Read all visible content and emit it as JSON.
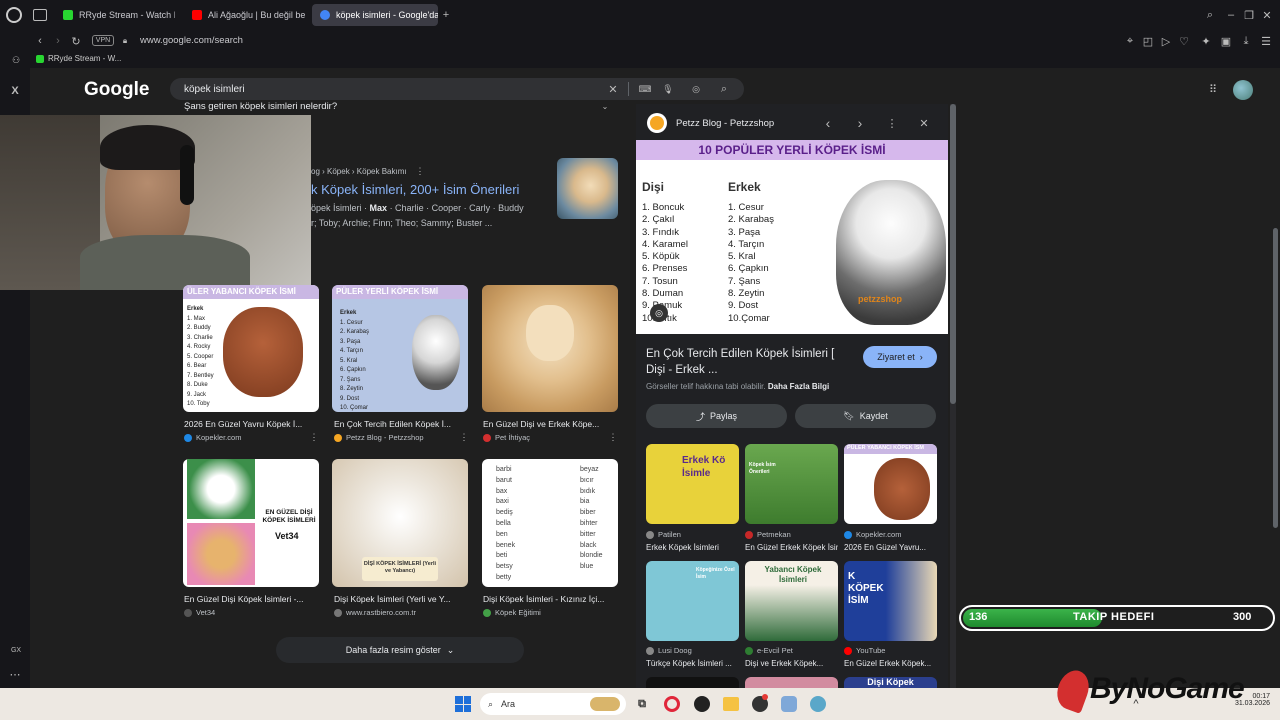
{
  "browser": {
    "tabs": [
      {
        "label": "RRyde Stream - Watch Liv",
        "color": "#28d631"
      },
      {
        "label": "Ali Ağaoğlu | Bu değil ben",
        "color": "#ff0000"
      },
      {
        "label": "köpek isimleri - Google'da",
        "color": "#4285f4"
      }
    ],
    "url": "www.google.com/search",
    "vpn_label": "VPN",
    "bookmark": "RRyde Stream - W..."
  },
  "sidebar": {
    "x_label": "X",
    "gx_label": "GX"
  },
  "google": {
    "logo": "Google",
    "query": "köpek isimleri",
    "top_snippet": "Şans getiren köpek isimleri nelerdir?",
    "result": {
      "breadcrumb": "og › Köpek › Köpek Bakımı",
      "title": "k Köpek İsimleri, 200+ İsim Önerileri",
      "line1_pre": "öpek İsimleri ·",
      "line1_bold": "Max",
      "line1_post": "· Charlie · Cooper · Carly · Buddy",
      "line2": "r; Toby; Archie; Finn; Theo; Sammy; Buster ..."
    },
    "images": [
      {
        "caption": "2026 En Güzel Yavru Köpek İ...",
        "source": "Kopekler.com",
        "title_text": "ÜLER YABANCI KÖPEK İSMİ",
        "src_color": "#1e88e5"
      },
      {
        "caption": "En Çok Tercih Edilen Köpek İ...",
        "source": "Petzz Blog - Petzzshop",
        "title_text": "PÜLER YERLİ KÖPEK İSMİ",
        "src_color": "#f5a623"
      },
      {
        "caption": "En Güzel Dişi ve Erkek Köpe...",
        "source": "Pet İhtiyaç",
        "title_text": "",
        "src_color": "#d32f2f"
      },
      {
        "caption": "En Güzel Dişi Köpek İsimleri -...",
        "source": "Vet34",
        "title_text": "EN GÜZEL DİŞİ KÖPEK İSİMLERİ",
        "src_color": "#555555"
      },
      {
        "caption": "Dişi Köpek İsimleri (Yerli ve Y...",
        "source": "www.rastbiero.com.tr",
        "title_text": "DİŞİ KÖPEK İSİMLERİ (Yerli ve Yabancı)",
        "src_color": "#777777"
      },
      {
        "caption": "Dişi Köpek İsimleri - Kızınız İçi...",
        "source": "Köpek Eğitimi",
        "title_text": "",
        "src_color": "#43a047"
      }
    ],
    "list_left": [
      "barbi",
      "barut",
      "bax",
      "baxi",
      "bediş",
      "bella",
      "ben",
      "benek",
      "beti",
      "betsy",
      "betty"
    ],
    "list_right": [
      "beyaz",
      "bıcır",
      "bıdık",
      "bia",
      "biber",
      "bihter",
      "bitter",
      "black",
      "blondie",
      "blue"
    ],
    "more_images": "Daha fazla resim göster"
  },
  "thumb_lists": {
    "male_title": "Erkek",
    "male": [
      "1. Max",
      "2. Buddy",
      "3. Charlie",
      "4. Rocky",
      "5. Cooper",
      "6. Bear",
      "7. Bentley",
      "8. Duke",
      "9. Jack",
      "10. Toby"
    ],
    "yerli_title": "Erkek",
    "yerli": [
      "1. Cesur",
      "2. Karabaş",
      "3. Paşa",
      "4. Tarçın",
      "5. Kral",
      "6. Çapkın",
      "7. Şans",
      "8. Zeytin",
      "9. Dost",
      "10. Çomar"
    ]
  },
  "panel": {
    "source": "Petzz Blog - Petzzshop",
    "image_title": "10 POPÜLER YERLİ KÖPEK İSMİ",
    "female_title": "Dişi",
    "female": [
      "1. Boncuk",
      "2. Çakıl",
      "3. Fındık",
      "4. Karamel",
      "5. Köpük",
      "6. Prenses",
      "7. Tosun",
      "8. Duman",
      "9. Pamuk",
      "10. Pıtık"
    ],
    "male_title": "Erkek",
    "male": [
      "1. Cesur",
      "2. Karabaş",
      "3. Paşa",
      "4. Tarçın",
      "5. Kral",
      "6. Çapkın",
      "7. Şans",
      "8. Zeytin",
      "9. Dost",
      "10.Çomar"
    ],
    "brand": "petzzshop",
    "title": "En Çok Tercih Edilen Köpek İsimleri [ Dişi - Erkek ...",
    "visit": "Ziyaret et",
    "copyright": "Görseller telif hakkına tabi olabilir.",
    "more_info": "Daha Fazla Bilgi",
    "share": "Paylaş",
    "save": "Kaydet",
    "related": [
      {
        "source": "Patilen",
        "caption": "Erkek Köpek İsimleri",
        "thumb_text": "Erkek Kö İsimle",
        "color": "#e8d23a",
        "src_color": "#888888"
      },
      {
        "source": "Petmekan",
        "caption": "En Güzel Erkek Köpek İsim...",
        "thumb_text": "Köpek İsim Önerileri",
        "color": "#4a9a3a",
        "src_color": "#c62828"
      },
      {
        "source": "Kopekler.com",
        "caption": "2026 En Güzel Yavru...",
        "thumb_text": "PÜLER YABANCI KÖPEK İSM",
        "color": "#ffffff",
        "src_color": "#1e88e5"
      },
      {
        "source": "Lusi Doog",
        "caption": "Türkçe Köpek İsimleri ...",
        "thumb_text": "Köpeğinize Özel İsim",
        "color": "#7fc7d6",
        "src_color": "#888888"
      },
      {
        "source": "e-Evcil Pet",
        "caption": "Dişi ve Erkek Köpek...",
        "thumb_text": "Yabancı Köpek İsimleri",
        "color": "#2f6b3a",
        "src_color": "#2e7d32"
      },
      {
        "source": "YouTube",
        "caption": "En Güzel Erkek Köpek...",
        "thumb_text": "K KÖPEK İSİM",
        "color": "#1f3f9a",
        "src_color": "#ff0000"
      }
    ],
    "bottom_peek": "Dişi Köpek"
  },
  "overlay": {
    "current": "136",
    "label": "TAKIP HEDEFI",
    "target": "300",
    "progress": 0.45,
    "brand": "ByNoGame"
  },
  "taskbar": {
    "search": "Ara",
    "time": "00:17",
    "date": "31.03.2026"
  }
}
